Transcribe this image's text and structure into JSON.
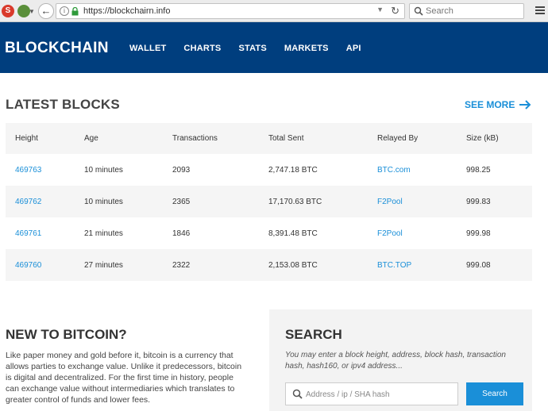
{
  "browser": {
    "url": "https://blockchairn.info",
    "search_placeholder": "Search",
    "ext1_glyph": "S"
  },
  "header": {
    "logo": "BLOCKCHAIN",
    "nav": [
      "WALLET",
      "CHARTS",
      "STATS",
      "MARKETS",
      "API"
    ]
  },
  "latest_blocks": {
    "title": "LATEST BLOCKS",
    "see_more": "SEE MORE",
    "columns": [
      "Height",
      "Age",
      "Transactions",
      "Total Sent",
      "Relayed By",
      "Size (kB)"
    ],
    "rows": [
      {
        "height": "469763",
        "age": "10 minutes",
        "transactions": "2093",
        "total_sent": "2,747.18 BTC",
        "relayed_by": "BTC.com",
        "size": "998.25"
      },
      {
        "height": "469762",
        "age": "10 minutes",
        "transactions": "2365",
        "total_sent": "17,170.63 BTC",
        "relayed_by": "F2Pool",
        "size": "999.83"
      },
      {
        "height": "469761",
        "age": "21 minutes",
        "transactions": "1846",
        "total_sent": "8,391.48 BTC",
        "relayed_by": "F2Pool",
        "size": "999.98"
      },
      {
        "height": "469760",
        "age": "27 minutes",
        "transactions": "2322",
        "total_sent": "2,153.08 BTC",
        "relayed_by": "BTC.TOP",
        "size": "999.08"
      }
    ]
  },
  "new_to_bitcoin": {
    "title": "NEW TO BITCOIN?",
    "text": "Like paper money and gold before it, bitcoin is a currency that allows parties to exchange value. Unlike it predecessors, bitcoin is digital and decentralized. For the first time in history, people can exchange value without intermediaries which translates to greater control of funds and lower fees."
  },
  "search": {
    "title": "SEARCH",
    "description": "You may enter a block height, address, block hash, transaction hash, hash160, or ipv4 address...",
    "placeholder": "Address / ip / SHA hash",
    "button": "Search"
  },
  "colors": {
    "header_bg": "#003e7e",
    "accent": "#1a8fd8"
  }
}
